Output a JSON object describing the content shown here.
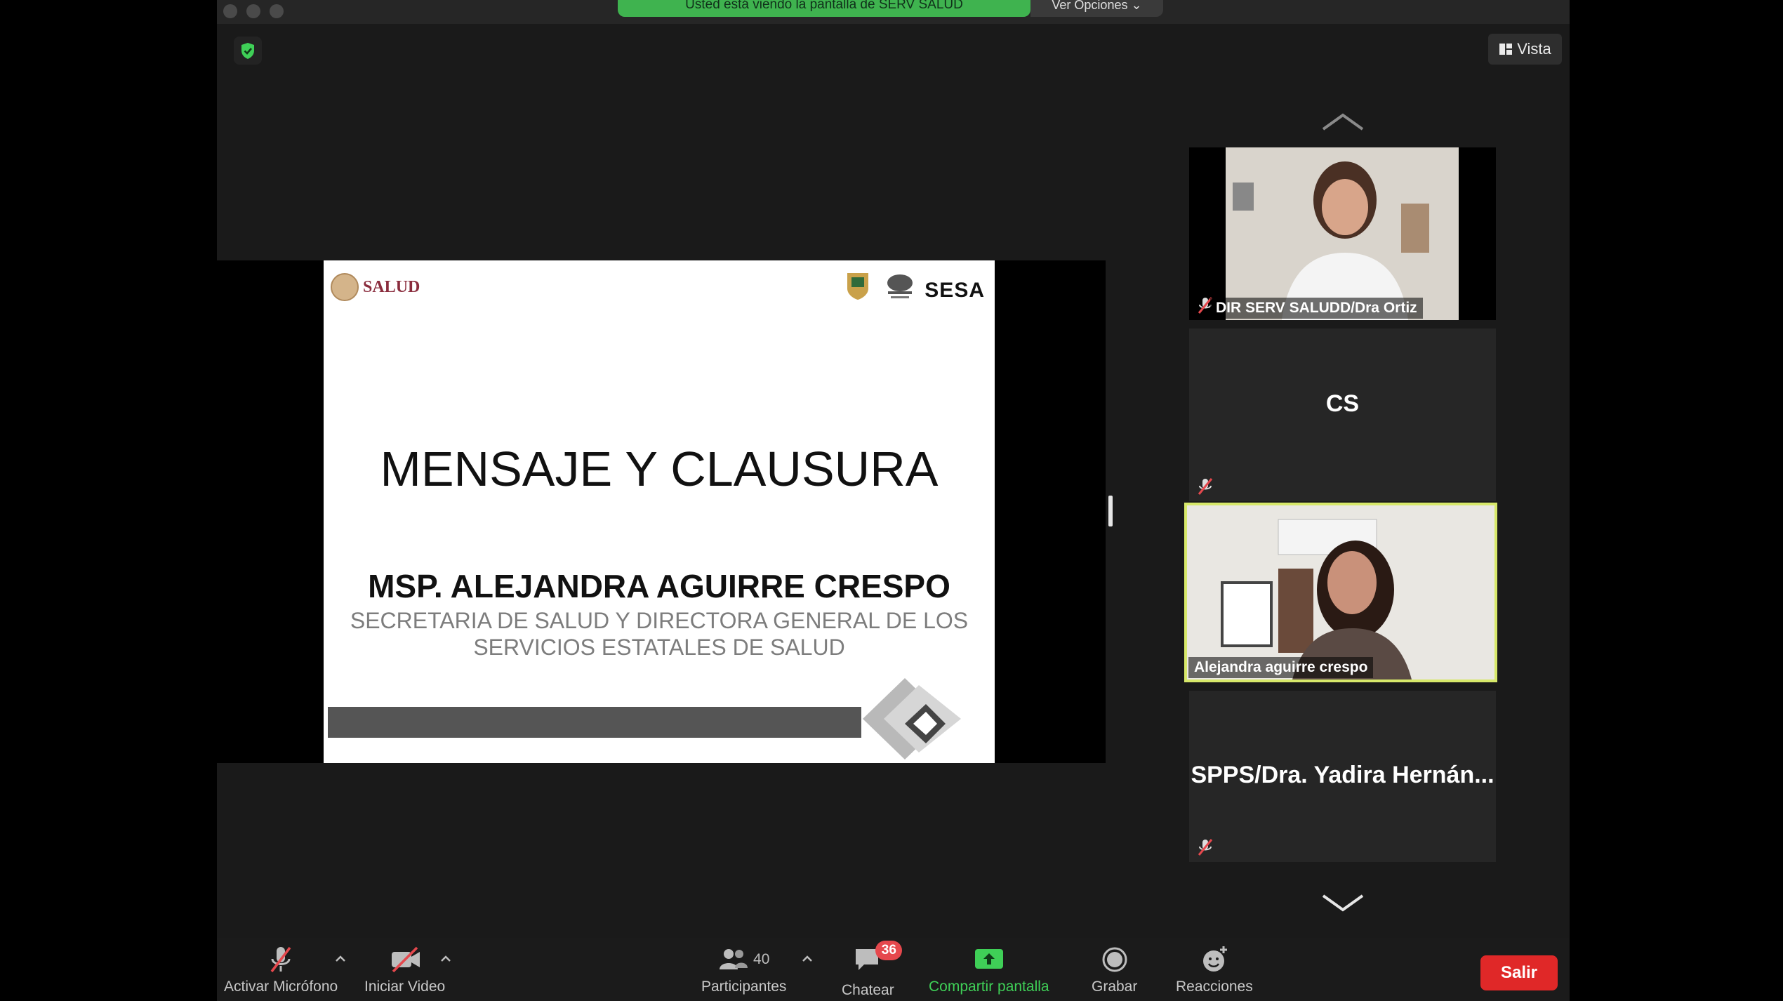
{
  "banner": {
    "text": "Usted está viendo la pantalla de SERV SALUD",
    "options_label": "Ver Opciones"
  },
  "header": {
    "view_label": "Vista"
  },
  "slide": {
    "logo_left": "SALUD",
    "logo_right": "SESA",
    "title": "MENSAJE Y CLAUSURA",
    "name": "MSP. ALEJANDRA AGUIRRE CRESPO",
    "role_line1": "SECRETARIA DE SALUD Y DIRECTORA GENERAL DE LOS",
    "role_line2": "SERVICIOS ESTATALES DE SALUD"
  },
  "participants_panel": {
    "tiles": [
      {
        "name": "DIR SERV SALUDD/Dra Ortiz",
        "muted": true,
        "video": true
      },
      {
        "initials": "CS",
        "muted": true,
        "video": false
      },
      {
        "name": "Alejandra aguirre crespo",
        "muted": false,
        "video": true,
        "active_speaker": true
      },
      {
        "name": "SPPS/Dra. Yadira Hernán...",
        "muted": true,
        "video": false
      }
    ]
  },
  "toolbar": {
    "mic_label": "Activar Micrófono",
    "video_label": "Iniciar Video",
    "participants_count": "40",
    "participants_label": "Participantes",
    "chat_badge": "36",
    "chat_label": "Chatear",
    "share_label": "Compartir pantalla",
    "record_label": "Grabar",
    "reactions_label": "Reacciones",
    "leave_label": "Salir"
  },
  "colors": {
    "banner_green": "#3fb34f",
    "active_speaker_border": "#d7e86a",
    "leave_red": "#e02828",
    "badge_red": "#e5484d",
    "share_green": "#3fcf57"
  }
}
